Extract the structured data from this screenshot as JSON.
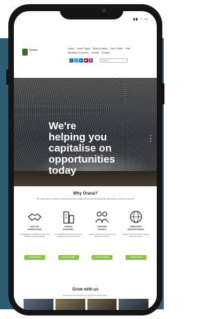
{
  "status_bar": {
    "time": "",
    "icons": "▮▮ ◔ ▭"
  },
  "header": {
    "logo_text": "Orana",
    "logo_sub": "",
    "nav": [
      "Invest",
      "Home Types",
      "Build & Invest",
      "Live & Work",
      "Visit",
      "Business & Careers",
      "Events",
      "Contact"
    ],
    "social": [
      {
        "name": "facebook-icon",
        "glyph": "f",
        "color": "#3b5998"
      },
      {
        "name": "twitter-icon",
        "glyph": "t",
        "color": "#1da1f2"
      },
      {
        "name": "linkedin-icon",
        "glyph": "in",
        "color": "#0077b5"
      },
      {
        "name": "youtube-icon",
        "glyph": "▶",
        "color": "#cc0000"
      },
      {
        "name": "instagram-icon",
        "glyph": "◎",
        "color": "#8a3ab9"
      }
    ],
    "search_placeholder": "Search"
  },
  "hero": {
    "title": "We're\nhelping you\ncapitalise on\nopportunities\ntoday",
    "dots": "•\n•\n•"
  },
  "why": {
    "heading": "Why Orana?",
    "intro": "The Orana region is a diverse, thriving area which provides businesses and people with opportunities to grow and succeed.",
    "cards": [
      {
        "title": "SKILLED\nWORKFORCE",
        "body": "Key Regions and workforce across many industries supporting growth.",
        "button": "LEARN MORE",
        "icon": "handshake-icon"
      },
      {
        "title": "STABLE\nECONOMY",
        "body": "Key industries and diverse economy supporting business investment.",
        "button": "LEARN MORE",
        "icon": "buildings-icon"
      },
      {
        "title": "THRIVING\nPEOPLE",
        "body": "Lifestyle, community and services for families and people.",
        "button": "LEARN MORE",
        "icon": "people-icon"
      },
      {
        "title": "EMERGING\nOPPORTUNITIES",
        "body": "Migration and new markets opening across the region.",
        "button": "LEARN MORE",
        "icon": "globe-icon"
      }
    ]
  },
  "grow": {
    "heading": "Grow with us",
    "intro": "Find out how we can help you grow in the Orana region."
  },
  "colors": {
    "accent": "#8bc34a",
    "background_panel": "#2e5c72"
  }
}
